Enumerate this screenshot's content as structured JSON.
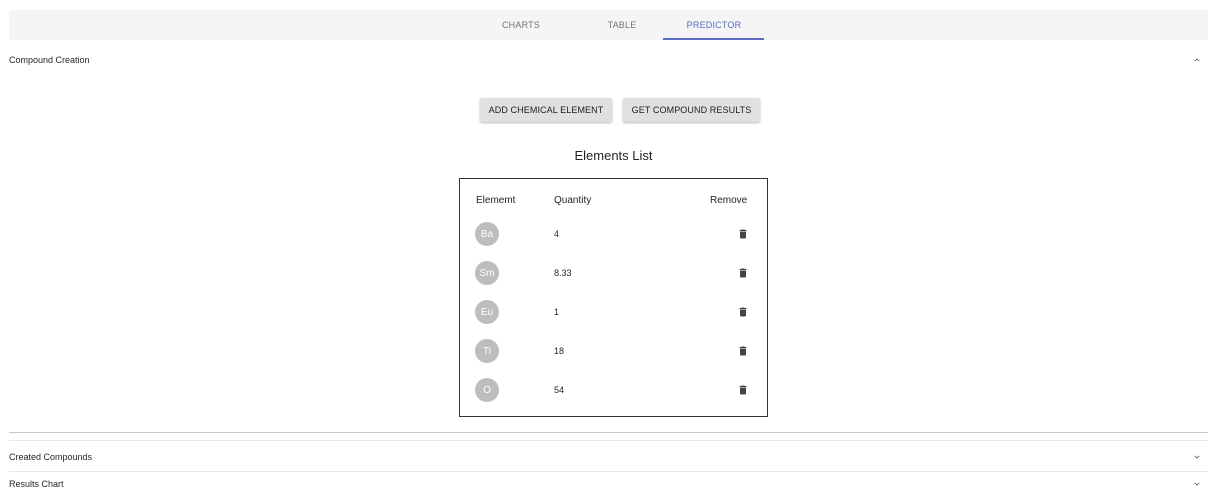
{
  "tabs": [
    {
      "label": "CHARTS",
      "active": false
    },
    {
      "label": "TABLE",
      "active": false
    },
    {
      "label": "PREDICTOR",
      "active": true
    }
  ],
  "accent_color": "#5c6bc0",
  "compound_panel": {
    "title": "Compound Creation",
    "expanded": true,
    "icon": "chevron-up-icon",
    "add_button_label": "ADD CHEMICAL ELEMENT",
    "results_button_label": "GET COMPOUND RESULTS",
    "list_title": "Elements List",
    "columns": {
      "element": "Elememt",
      "quantity": "Quantity",
      "remove": "Remove"
    },
    "rows": [
      {
        "symbol": "Ba",
        "quantity": "4"
      },
      {
        "symbol": "Sm",
        "quantity": "8.33"
      },
      {
        "symbol": "Eu",
        "quantity": "1"
      },
      {
        "symbol": "Ti",
        "quantity": "18"
      },
      {
        "symbol": "O",
        "quantity": "54"
      }
    ],
    "remove_icon": "trash-icon"
  },
  "created_panel": {
    "title": "Created Compounds",
    "expanded": false,
    "icon": "chevron-down-icon"
  },
  "results_panel": {
    "title": "Results Chart",
    "expanded": false,
    "icon": "chevron-down-icon"
  }
}
